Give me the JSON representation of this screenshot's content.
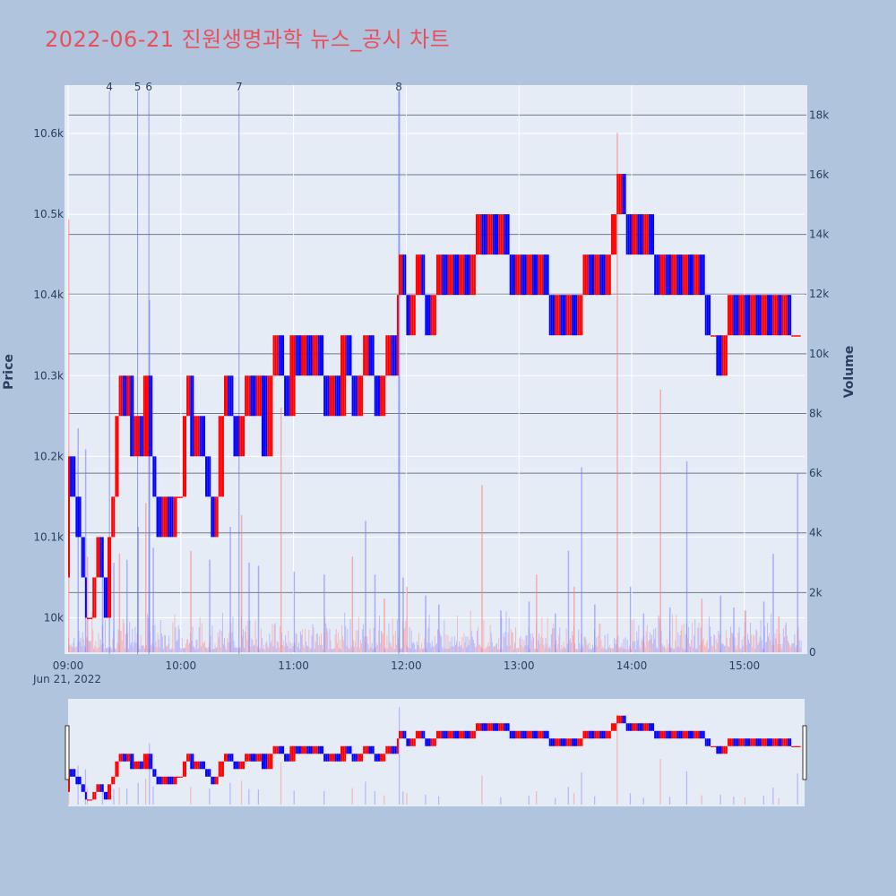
{
  "title": "2022-06-21 진원생명과학 뉴스_공시 차트",
  "colors": {
    "up": "#ff0000",
    "down": "#0000ff",
    "plot_bg": "#e5ecf6",
    "page_bg": "#b0c4de",
    "title": "#e8505b"
  },
  "chart_data": {
    "type": "candlestick",
    "title": "2022-06-21 진원생명과학 뉴스_공시 차트",
    "ylabel": "Price",
    "y2label": "Volume",
    "date_label": "Jun 21, 2022",
    "x_ticks": [
      "09:00",
      "10:00",
      "11:00",
      "12:00",
      "13:00",
      "14:00",
      "15:00"
    ],
    "y_ticks": [
      "10k",
      "10.1k",
      "10.2k",
      "10.3k",
      "10.4k",
      "10.5k",
      "10.6k"
    ],
    "y_tick_values": [
      10000,
      10100,
      10200,
      10300,
      10400,
      10500,
      10600
    ],
    "y2_ticks": [
      "0",
      "2k",
      "4k",
      "6k",
      "8k",
      "10k",
      "12k",
      "14k",
      "16k",
      "18k"
    ],
    "y2_tick_values": [
      0,
      2000,
      4000,
      6000,
      8000,
      10000,
      12000,
      14000,
      16000,
      18000
    ],
    "ylim": [
      9955,
      10660
    ],
    "y2lim": [
      0,
      19000
    ],
    "x_range": [
      "09:00",
      "15:30"
    ],
    "events": [
      {
        "label": "4",
        "time": "09:22"
      },
      {
        "label": "5",
        "time": "09:37"
      },
      {
        "label": "6",
        "time": "09:43"
      },
      {
        "label": "7",
        "time": "10:31"
      },
      {
        "label": "8",
        "time": "11:56"
      }
    ],
    "price_path": [
      [
        "09:00",
        10050
      ],
      [
        "09:01",
        10200
      ],
      [
        "09:04",
        10150
      ],
      [
        "09:07",
        10100
      ],
      [
        "09:09",
        10050
      ],
      [
        "09:10",
        10000
      ],
      [
        "09:13",
        10000
      ],
      [
        "09:15",
        10050
      ],
      [
        "09:17",
        10100
      ],
      [
        "09:19",
        10050
      ],
      [
        "09:21",
        10000
      ],
      [
        "09:23",
        10100
      ],
      [
        "09:25",
        10150
      ],
      [
        "09:27",
        10250
      ],
      [
        "09:29",
        10300
      ],
      [
        "09:31",
        10250
      ],
      [
        "09:33",
        10300
      ],
      [
        "09:35",
        10200
      ],
      [
        "09:38",
        10250
      ],
      [
        "09:40",
        10200
      ],
      [
        "09:43",
        10300
      ],
      [
        "09:45",
        10200
      ],
      [
        "09:47",
        10150
      ],
      [
        "09:50",
        10100
      ],
      [
        "09:53",
        10150
      ],
      [
        "09:56",
        10100
      ],
      [
        "09:58",
        10150
      ],
      [
        "10:01",
        10150
      ],
      [
        "10:03",
        10250
      ],
      [
        "10:05",
        10300
      ],
      [
        "10:07",
        10200
      ],
      [
        "10:10",
        10250
      ],
      [
        "10:13",
        10200
      ],
      [
        "10:16",
        10150
      ],
      [
        "10:18",
        10100
      ],
      [
        "10:20",
        10150
      ],
      [
        "10:23",
        10250
      ],
      [
        "10:25",
        10300
      ],
      [
        "10:28",
        10250
      ],
      [
        "10:31",
        10200
      ],
      [
        "10:34",
        10250
      ],
      [
        "10:37",
        10300
      ],
      [
        "10:40",
        10250
      ],
      [
        "10:43",
        10300
      ],
      [
        "10:46",
        10200
      ],
      [
        "10:49",
        10300
      ],
      [
        "10:52",
        10350
      ],
      [
        "10:55",
        10300
      ],
      [
        "10:58",
        10250
      ],
      [
        "11:01",
        10350
      ],
      [
        "11:04",
        10300
      ],
      [
        "11:07",
        10350
      ],
      [
        "11:10",
        10300
      ],
      [
        "11:13",
        10350
      ],
      [
        "11:16",
        10300
      ],
      [
        "11:19",
        10250
      ],
      [
        "11:22",
        10300
      ],
      [
        "11:25",
        10250
      ],
      [
        "11:28",
        10350
      ],
      [
        "11:31",
        10300
      ],
      [
        "11:34",
        10250
      ],
      [
        "11:37",
        10300
      ],
      [
        "11:40",
        10350
      ],
      [
        "11:43",
        10300
      ],
      [
        "11:46",
        10250
      ],
      [
        "11:49",
        10300
      ],
      [
        "11:52",
        10350
      ],
      [
        "11:55",
        10300
      ],
      [
        "11:56",
        10400
      ],
      [
        "11:58",
        10450
      ],
      [
        "12:00",
        10400
      ],
      [
        "12:02",
        10350
      ],
      [
        "12:05",
        10400
      ],
      [
        "12:08",
        10450
      ],
      [
        "12:10",
        10400
      ],
      [
        "12:13",
        10350
      ],
      [
        "12:16",
        10400
      ],
      [
        "12:19",
        10450
      ],
      [
        "12:22",
        10400
      ],
      [
        "12:25",
        10450
      ],
      [
        "12:28",
        10400
      ],
      [
        "12:31",
        10450
      ],
      [
        "12:34",
        10400
      ],
      [
        "12:37",
        10450
      ],
      [
        "12:40",
        10500
      ],
      [
        "12:43",
        10450
      ],
      [
        "12:46",
        10500
      ],
      [
        "12:49",
        10450
      ],
      [
        "12:52",
        10500
      ],
      [
        "12:55",
        10450
      ],
      [
        "12:58",
        10400
      ],
      [
        "13:01",
        10450
      ],
      [
        "13:04",
        10400
      ],
      [
        "13:07",
        10450
      ],
      [
        "13:10",
        10400
      ],
      [
        "13:13",
        10450
      ],
      [
        "13:16",
        10400
      ],
      [
        "13:19",
        10350
      ],
      [
        "13:22",
        10400
      ],
      [
        "13:25",
        10350
      ],
      [
        "13:28",
        10400
      ],
      [
        "13:31",
        10350
      ],
      [
        "13:34",
        10400
      ],
      [
        "13:37",
        10450
      ],
      [
        "13:40",
        10400
      ],
      [
        "13:43",
        10450
      ],
      [
        "13:46",
        10400
      ],
      [
        "13:49",
        10450
      ],
      [
        "13:52",
        10500
      ],
      [
        "13:55",
        10550
      ],
      [
        "13:57",
        10500
      ],
      [
        "14:00",
        10450
      ],
      [
        "14:03",
        10500
      ],
      [
        "14:06",
        10450
      ],
      [
        "14:09",
        10500
      ],
      [
        "14:12",
        10450
      ],
      [
        "14:15",
        10400
      ],
      [
        "14:18",
        10450
      ],
      [
        "14:21",
        10400
      ],
      [
        "14:24",
        10450
      ],
      [
        "14:27",
        10400
      ],
      [
        "14:30",
        10450
      ],
      [
        "14:33",
        10400
      ],
      [
        "14:36",
        10450
      ],
      [
        "14:39",
        10400
      ],
      [
        "14:42",
        10350
      ],
      [
        "14:45",
        10350
      ],
      [
        "14:48",
        10300
      ],
      [
        "14:51",
        10350
      ],
      [
        "14:54",
        10400
      ],
      [
        "14:57",
        10350
      ],
      [
        "15:00",
        10400
      ],
      [
        "15:03",
        10350
      ],
      [
        "15:06",
        10400
      ],
      [
        "15:09",
        10350
      ],
      [
        "15:12",
        10400
      ],
      [
        "15:15",
        10350
      ],
      [
        "15:18",
        10400
      ],
      [
        "15:20",
        10350
      ],
      [
        "15:23",
        10400
      ],
      [
        "15:25",
        10350
      ],
      [
        "15:30",
        10350
      ]
    ],
    "volume_spikes": [
      [
        "09:00",
        14500
      ],
      [
        "09:05",
        7500
      ],
      [
        "09:09",
        6800
      ],
      [
        "09:10",
        3200
      ],
      [
        "09:18",
        3500
      ],
      [
        "09:24",
        3000
      ],
      [
        "09:27",
        3300
      ],
      [
        "09:31",
        3100
      ],
      [
        "09:37",
        4200
      ],
      [
        "09:41",
        5000
      ],
      [
        "09:43",
        11800
      ],
      [
        "09:45",
        3500
      ],
      [
        "10:05",
        3400
      ],
      [
        "10:15",
        3100
      ],
      [
        "10:26",
        4200
      ],
      [
        "10:32",
        4600
      ],
      [
        "10:36",
        3000
      ],
      [
        "10:41",
        2900
      ],
      [
        "10:53",
        8200
      ],
      [
        "11:00",
        2700
      ],
      [
        "11:16",
        2600
      ],
      [
        "11:31",
        3200
      ],
      [
        "11:38",
        4400
      ],
      [
        "11:43",
        2600
      ],
      [
        "11:48",
        1800
      ],
      [
        "11:56",
        18800
      ],
      [
        "11:58",
        2500
      ],
      [
        "12:00",
        2200
      ],
      [
        "12:10",
        1900
      ],
      [
        "12:17",
        1600
      ],
      [
        "12:40",
        5600
      ],
      [
        "12:50",
        1400
      ],
      [
        "13:05",
        1700
      ],
      [
        "13:09",
        2600
      ],
      [
        "13:19",
        1300
      ],
      [
        "13:26",
        3400
      ],
      [
        "13:29",
        2200
      ],
      [
        "13:33",
        6200
      ],
      [
        "13:40",
        1600
      ],
      [
        "13:52",
        17400
      ],
      [
        "13:59",
        2200
      ],
      [
        "14:06",
        1300
      ],
      [
        "14:15",
        8800
      ],
      [
        "14:20",
        1500
      ],
      [
        "14:29",
        6400
      ],
      [
        "14:37",
        1800
      ],
      [
        "14:47",
        1900
      ],
      [
        "14:54",
        1500
      ],
      [
        "15:00",
        1400
      ],
      [
        "15:10",
        1700
      ],
      [
        "15:15",
        3300
      ],
      [
        "15:18",
        1200
      ],
      [
        "15:28",
        6000
      ]
    ]
  },
  "rangeslider": {
    "visible": true
  }
}
